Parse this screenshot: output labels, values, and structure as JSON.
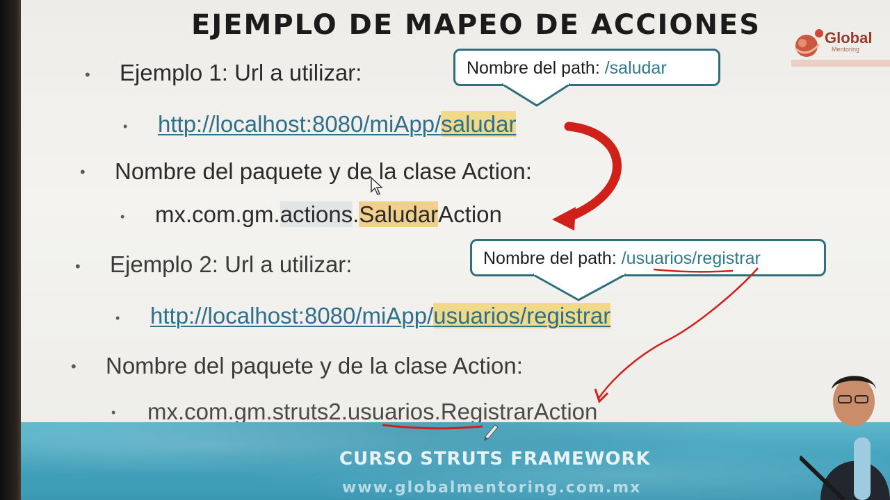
{
  "slide": {
    "title": "EJEMPLO DE MAPEO DE ACCIONES",
    "logo": {
      "name": "Global",
      "tagline": "Mentoring"
    },
    "example1": {
      "heading": "Ejemplo 1: Url a utilizar:",
      "url_base": "http://localhost:8080/miApp/",
      "url_path": "saludar",
      "package_heading": "Nombre del paquete y de la clase Action:",
      "package_prefix": "mx.com.gm.",
      "package_segment": "actions",
      "package_dot": ".",
      "class_highlight": "Saludar",
      "class_suffix": "Action",
      "callout_label": "Nombre del path: ",
      "callout_value": "/saludar"
    },
    "example2": {
      "heading": "Ejemplo 2: Url a utilizar:",
      "url_base": "http://localhost:8080/miApp/",
      "url_path": "usuarios/registrar",
      "package_heading": "Nombre del paquete y de la clase Action:",
      "package_prefix": "mx.com.gm.struts2.",
      "package_segment": "usuarios",
      "package_dot": ".",
      "class_suffix": "RegistrarAction",
      "callout_label": "Nombre del path: ",
      "callout_value": "/usuarios/registrar"
    },
    "footer": {
      "title": "CURSO STRUTS FRAMEWORK",
      "url": "www.globalmentoring.com.mx"
    },
    "bullet_glyph": "•"
  },
  "colors": {
    "link": "#2f6f8a",
    "highlight": "#f1d98a",
    "callout_border": "#2e6f7d",
    "arrow_red": "#d0201a",
    "footer_blue": "#43a3bd"
  },
  "icons": {
    "mouse_cursor": "mouse-cursor-icon",
    "pen_cursor": "pen-cursor-icon"
  }
}
